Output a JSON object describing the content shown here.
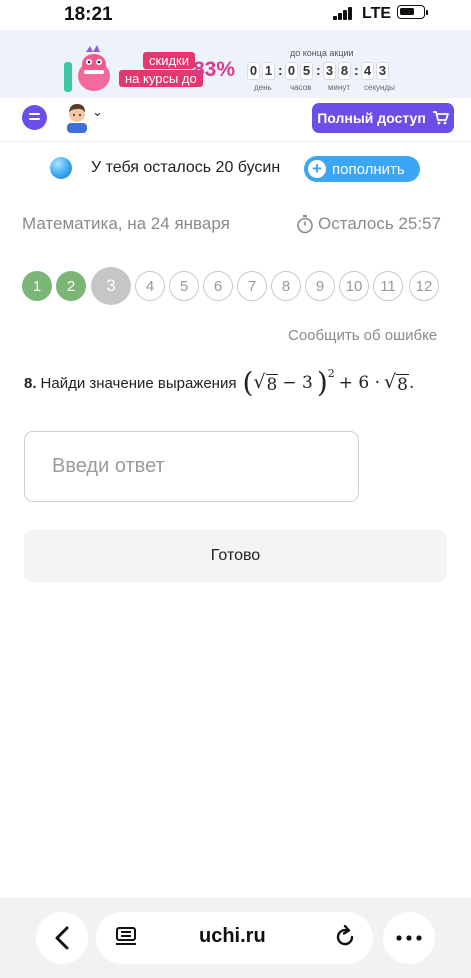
{
  "status_bar": {
    "time": "18:21",
    "network": "LTE"
  },
  "promo": {
    "tag_line1": "скидки",
    "tag_line2": "на курсы до",
    "percent": "83%",
    "until_label": "до конца акции",
    "timer": {
      "days": [
        "0",
        "1"
      ],
      "hours": [
        "0",
        "5"
      ],
      "minutes": [
        "3",
        "8"
      ],
      "seconds": [
        "4",
        "3"
      ]
    },
    "labels": {
      "days": "день",
      "hours": "часов",
      "minutes": "минут",
      "seconds": "секунды"
    }
  },
  "header": {
    "full_access_label": "Полный доступ"
  },
  "beads": {
    "text": "У тебя осталось 20 бусин",
    "topup_label": "пополнить"
  },
  "lesson": {
    "subject": "Математика, на 24 января",
    "time_left": "Осталось 25:57"
  },
  "questions": {
    "items": [
      {
        "n": "1",
        "state": "done"
      },
      {
        "n": "2",
        "state": "done"
      },
      {
        "n": "3",
        "state": "current"
      },
      {
        "n": "4",
        "state": "todo"
      },
      {
        "n": "5",
        "state": "todo"
      },
      {
        "n": "6",
        "state": "todo"
      },
      {
        "n": "7",
        "state": "todo"
      },
      {
        "n": "8",
        "state": "todo"
      },
      {
        "n": "9",
        "state": "todo"
      },
      {
        "n": "10",
        "state": "todo"
      },
      {
        "n": "11",
        "state": "todo"
      },
      {
        "n": "12",
        "state": "todo"
      }
    ],
    "colors": {
      "done": "#7bb677",
      "current": "#c6c6c6"
    }
  },
  "report_label": "Сообщить об ошибке",
  "task": {
    "number": "8.",
    "text": "Найди значение выражения",
    "expr": {
      "radicand": "8",
      "minus": "− 3",
      "power": "2",
      "plus": "+ 6 ·",
      "radicand2": "8",
      "end": "."
    }
  },
  "answer": {
    "placeholder": "Введи ответ"
  },
  "done_label": "Готово",
  "browser": {
    "url": "uchi.ru"
  },
  "colors": {
    "accent": "#6b4ee8",
    "topup": "#3ba6f4",
    "promo": "#e4376e"
  }
}
